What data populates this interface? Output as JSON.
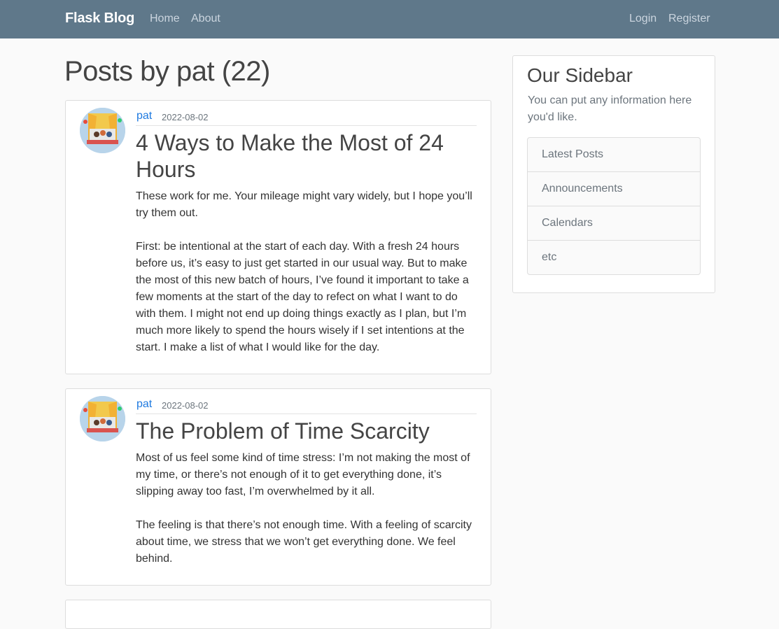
{
  "navbar": {
    "brand": "Flask Blog",
    "links_left": [
      "Home",
      "About"
    ],
    "links_right": [
      "Login",
      "Register"
    ],
    "background": "#5f788a"
  },
  "page_title": "Posts by pat (22)",
  "posts": [
    {
      "author": "pat",
      "date": "2022-08-02",
      "title": "4 Ways to Make the Most of 24 Hours",
      "content": "These work for me. Your mileage might vary widely, but I hope you’ll try them out.\n\nFirst: be intentional at the start of each day. With a fresh 24 hours before us, it’s easy to just get started in our usual way. But to make the most of this new batch of hours, I’ve found it important to take a few moments at the start of the day to refect on what I want to do with them. I might not end up doing things exactly as I plan, but I’m much more likely to spend the hours wisely if I set intentions at the start. I make a list of what I would like for the day."
    },
    {
      "author": "pat",
      "date": "2022-08-02",
      "title": "The Problem of Time Scarcity",
      "content": "Most of us feel some kind of time stress: I’m not making the most of my time, or there’s not enough of it to get everything done, it’s slipping away too fast, I’m overwhelmed by it all.\n\nThe feeling is that there’s not enough time. With a feeling of scarcity about time, we stress that we won’t get everything done. We feel behind."
    }
  ],
  "sidebar": {
    "title": "Our Sidebar",
    "text": "You can put any information here you'd like.",
    "items": [
      "Latest Posts",
      "Announcements",
      "Calendars",
      "etc"
    ]
  },
  "colors": {
    "link": "#1f7ae0",
    "muted": "#6c757d"
  },
  "icons": {
    "avatar": "profile-picture-icon"
  }
}
